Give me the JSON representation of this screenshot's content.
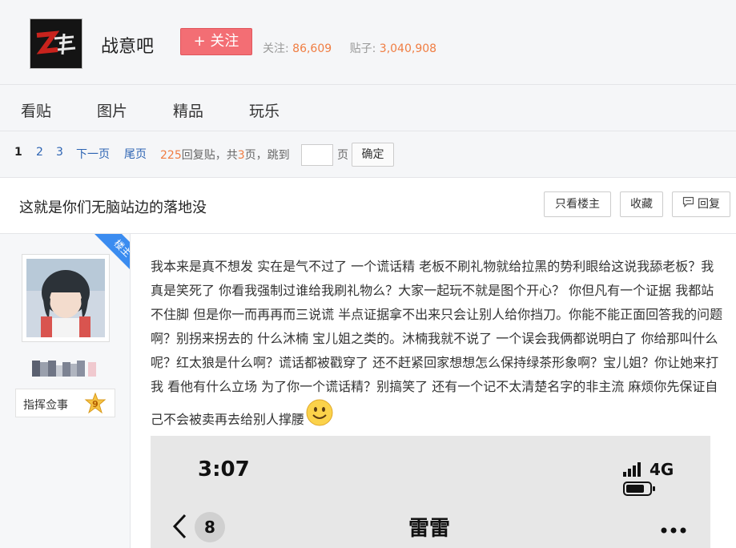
{
  "forum": {
    "name": "战意吧",
    "follow_label": "+ 关注",
    "followers_label": "关注:",
    "followers": "86,609",
    "posts_label": "贴子:",
    "posts": "3,040,908"
  },
  "nav": {
    "items": [
      "看贴",
      "图片",
      "精品",
      "玩乐"
    ]
  },
  "pager": {
    "pages": [
      "1",
      "2",
      "3"
    ],
    "next": "下一页",
    "last": "尾页",
    "reply_count": "225",
    "reply_suffix": "回复贴，共",
    "total_pages": "3",
    "page_suffix": "页，跳到",
    "page_unit": "页",
    "confirm": "确定"
  },
  "thread": {
    "title": "这就是你们无脑站边的落地没",
    "only_op": "只看楼主",
    "favorite": "收藏",
    "reply": "回复"
  },
  "author": {
    "tag": "楼主",
    "title": "指挥佥事",
    "level": "9"
  },
  "post": {
    "text": "我本来是真不想发 实在是气不过了 一个谎话精 老板不刷礼物就给拉黑的势利眼给这说我舔老板？我真是笑死了 你看我强制过谁给我刷礼物么？大家一起玩不就是图个开心？ 你但凡有一个证据 我都站不住脚 但是你一而再再而三说谎 半点证据拿不出来只会让别人给你挡刀。你能不能正面回答我的问题啊？别拐来拐去的 什么沐楠 宝儿姐之类的。沐楠我就不说了 一个误会我俩都说明白了 你给那叫什么呢？红太狼是什么啊？谎话都被戳穿了 还不赶紧回家想想怎么保持绿茶形象啊？宝儿姐？你让她来打我 看他有什么立场 为了你一个谎话精？别搞笑了 还有一个记不太清楚名字的非主流 麻烦你先保证自己不会被卖再去给别人撑腰"
  },
  "screenshot": {
    "time": "3:07",
    "network": "4G",
    "back_count": "8",
    "chat_name": "雷雷"
  },
  "colors": {
    "follow": "#f36e74",
    "link": "#2d64b3",
    "number": "#f07d42",
    "lz_tag": "#3b8cf0"
  }
}
